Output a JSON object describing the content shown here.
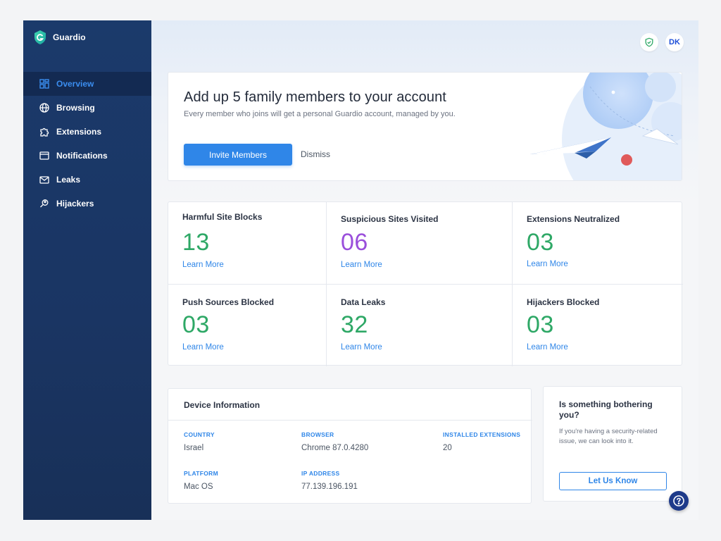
{
  "brand": {
    "name": "Guardio"
  },
  "sidebar": {
    "items": [
      {
        "label": "Overview",
        "icon": "grid-icon",
        "active": true
      },
      {
        "label": "Browsing",
        "icon": "globe-icon",
        "active": false
      },
      {
        "label": "Extensions",
        "icon": "puzzle-icon",
        "active": false
      },
      {
        "label": "Notifications",
        "icon": "browser-window-icon",
        "active": false
      },
      {
        "label": "Leaks",
        "icon": "mail-icon",
        "active": false
      },
      {
        "label": "Hijackers",
        "icon": "search-person-icon",
        "active": false
      }
    ]
  },
  "header": {
    "avatar_initials": "DK"
  },
  "banner": {
    "title": "Add up 5 family members to your account",
    "subtitle": "Every member who joins will get a personal Guardio account, managed by you.",
    "primary_button": "Invite Members",
    "dismiss_button": "Dismiss"
  },
  "stats": [
    {
      "label": "Harmful Site Blocks",
      "value": "13",
      "link": "Learn More",
      "color": "#2ea866"
    },
    {
      "label": "Suspicious Sites Visited",
      "value": "06",
      "link": "Learn More",
      "color": "#9a4fdb"
    },
    {
      "label": "Extensions Neutralized",
      "value": "03",
      "link": "Learn More",
      "color": "#2ea866"
    },
    {
      "label": "Push Sources Blocked",
      "value": "03",
      "link": "Learn More",
      "color": "#2ea866"
    },
    {
      "label": "Data Leaks",
      "value": "32",
      "link": "Learn More",
      "color": "#2ea866"
    },
    {
      "label": "Hijackers Blocked",
      "value": "03",
      "link": "Learn More",
      "color": "#2ea866"
    }
  ],
  "device": {
    "title": "Device Information",
    "fields": [
      {
        "label": "COUNTRY",
        "value": "Israel"
      },
      {
        "label": "BROWSER",
        "value": "Chrome 87.0.4280"
      },
      {
        "label": "INSTALLED EXTENSIONS",
        "value": "20"
      },
      {
        "label": "PLATFORM",
        "value": "Mac OS"
      },
      {
        "label": "IP ADDRESS",
        "value": "77.139.196.191"
      }
    ]
  },
  "help": {
    "title": "Is something bothering you?",
    "text": "If you're having a security-related issue, we can look into it.",
    "button": "Let Us Know"
  },
  "colors": {
    "accent": "#2f86e8",
    "sidebar": "#1b3a6b",
    "success": "#2ea866",
    "purple": "#9a4fdb"
  }
}
